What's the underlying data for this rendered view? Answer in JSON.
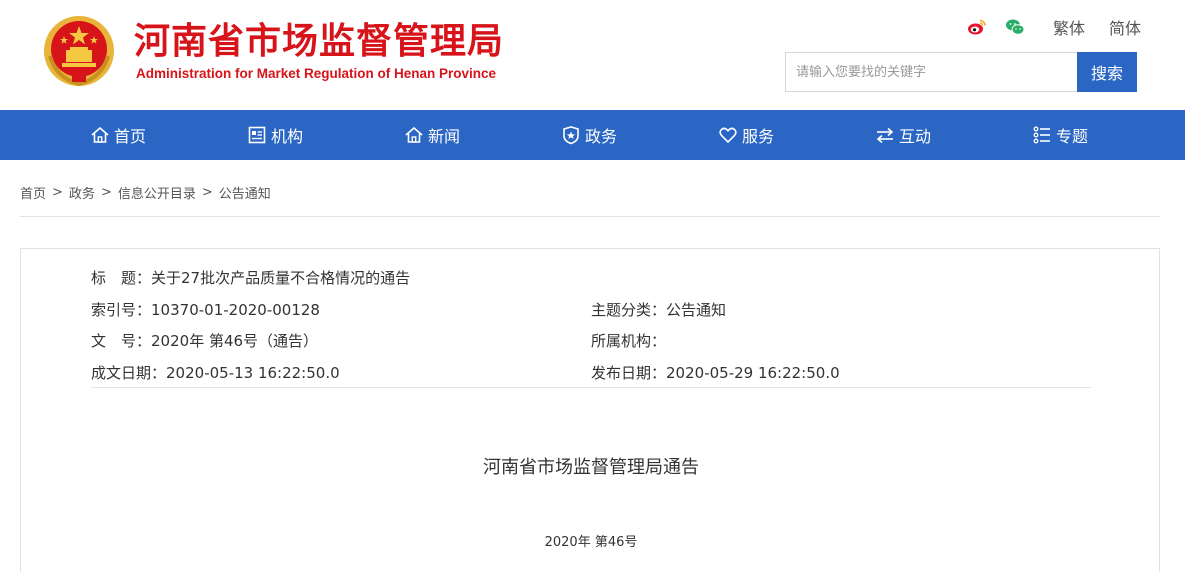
{
  "header": {
    "site_title": "河南省市场监督管理局",
    "site_subtitle": "Administration for Market Regulation of Henan Province",
    "weibo_icon": "weibo-icon",
    "wechat_icon": "wechat-icon",
    "lang_traditional": "繁体",
    "lang_simplified": "简体",
    "search_placeholder": "请输入您要找的关键字",
    "search_button": "搜索",
    "title_color": "#d7141a"
  },
  "nav": {
    "bg_color": "#2b66c4",
    "items": [
      {
        "label": "首页",
        "icon": "home-icon"
      },
      {
        "label": "机构",
        "icon": "org-icon"
      },
      {
        "label": "新闻",
        "icon": "news-icon"
      },
      {
        "label": "政务",
        "icon": "gov-icon"
      },
      {
        "label": "服务",
        "icon": "service-icon"
      },
      {
        "label": "互动",
        "icon": "interact-icon"
      },
      {
        "label": "专题",
        "icon": "topic-icon"
      }
    ]
  },
  "breadcrumb": [
    "首页",
    "政务",
    "信息公开目录",
    "公告通知"
  ],
  "meta": {
    "title_label": "标　题：",
    "title_value": "关于27批次产品质量不合格情况的通告",
    "index_label": "索引号：",
    "index_value": "10370-01-2020-00128",
    "category_label": "主题分类：",
    "category_value": "公告通知",
    "docno_label": "文　号：",
    "docno_value": "2020年 第46号（通告）",
    "org_label": "所属机构：",
    "org_value": "",
    "created_label": "成文日期：",
    "created_value": "2020-05-13 16:22:50.0",
    "published_label": "发布日期：",
    "published_value": "2020-05-29 16:22:50.0"
  },
  "document": {
    "title": "河南省市场监督管理局通告",
    "number": "2020年 第46号"
  }
}
